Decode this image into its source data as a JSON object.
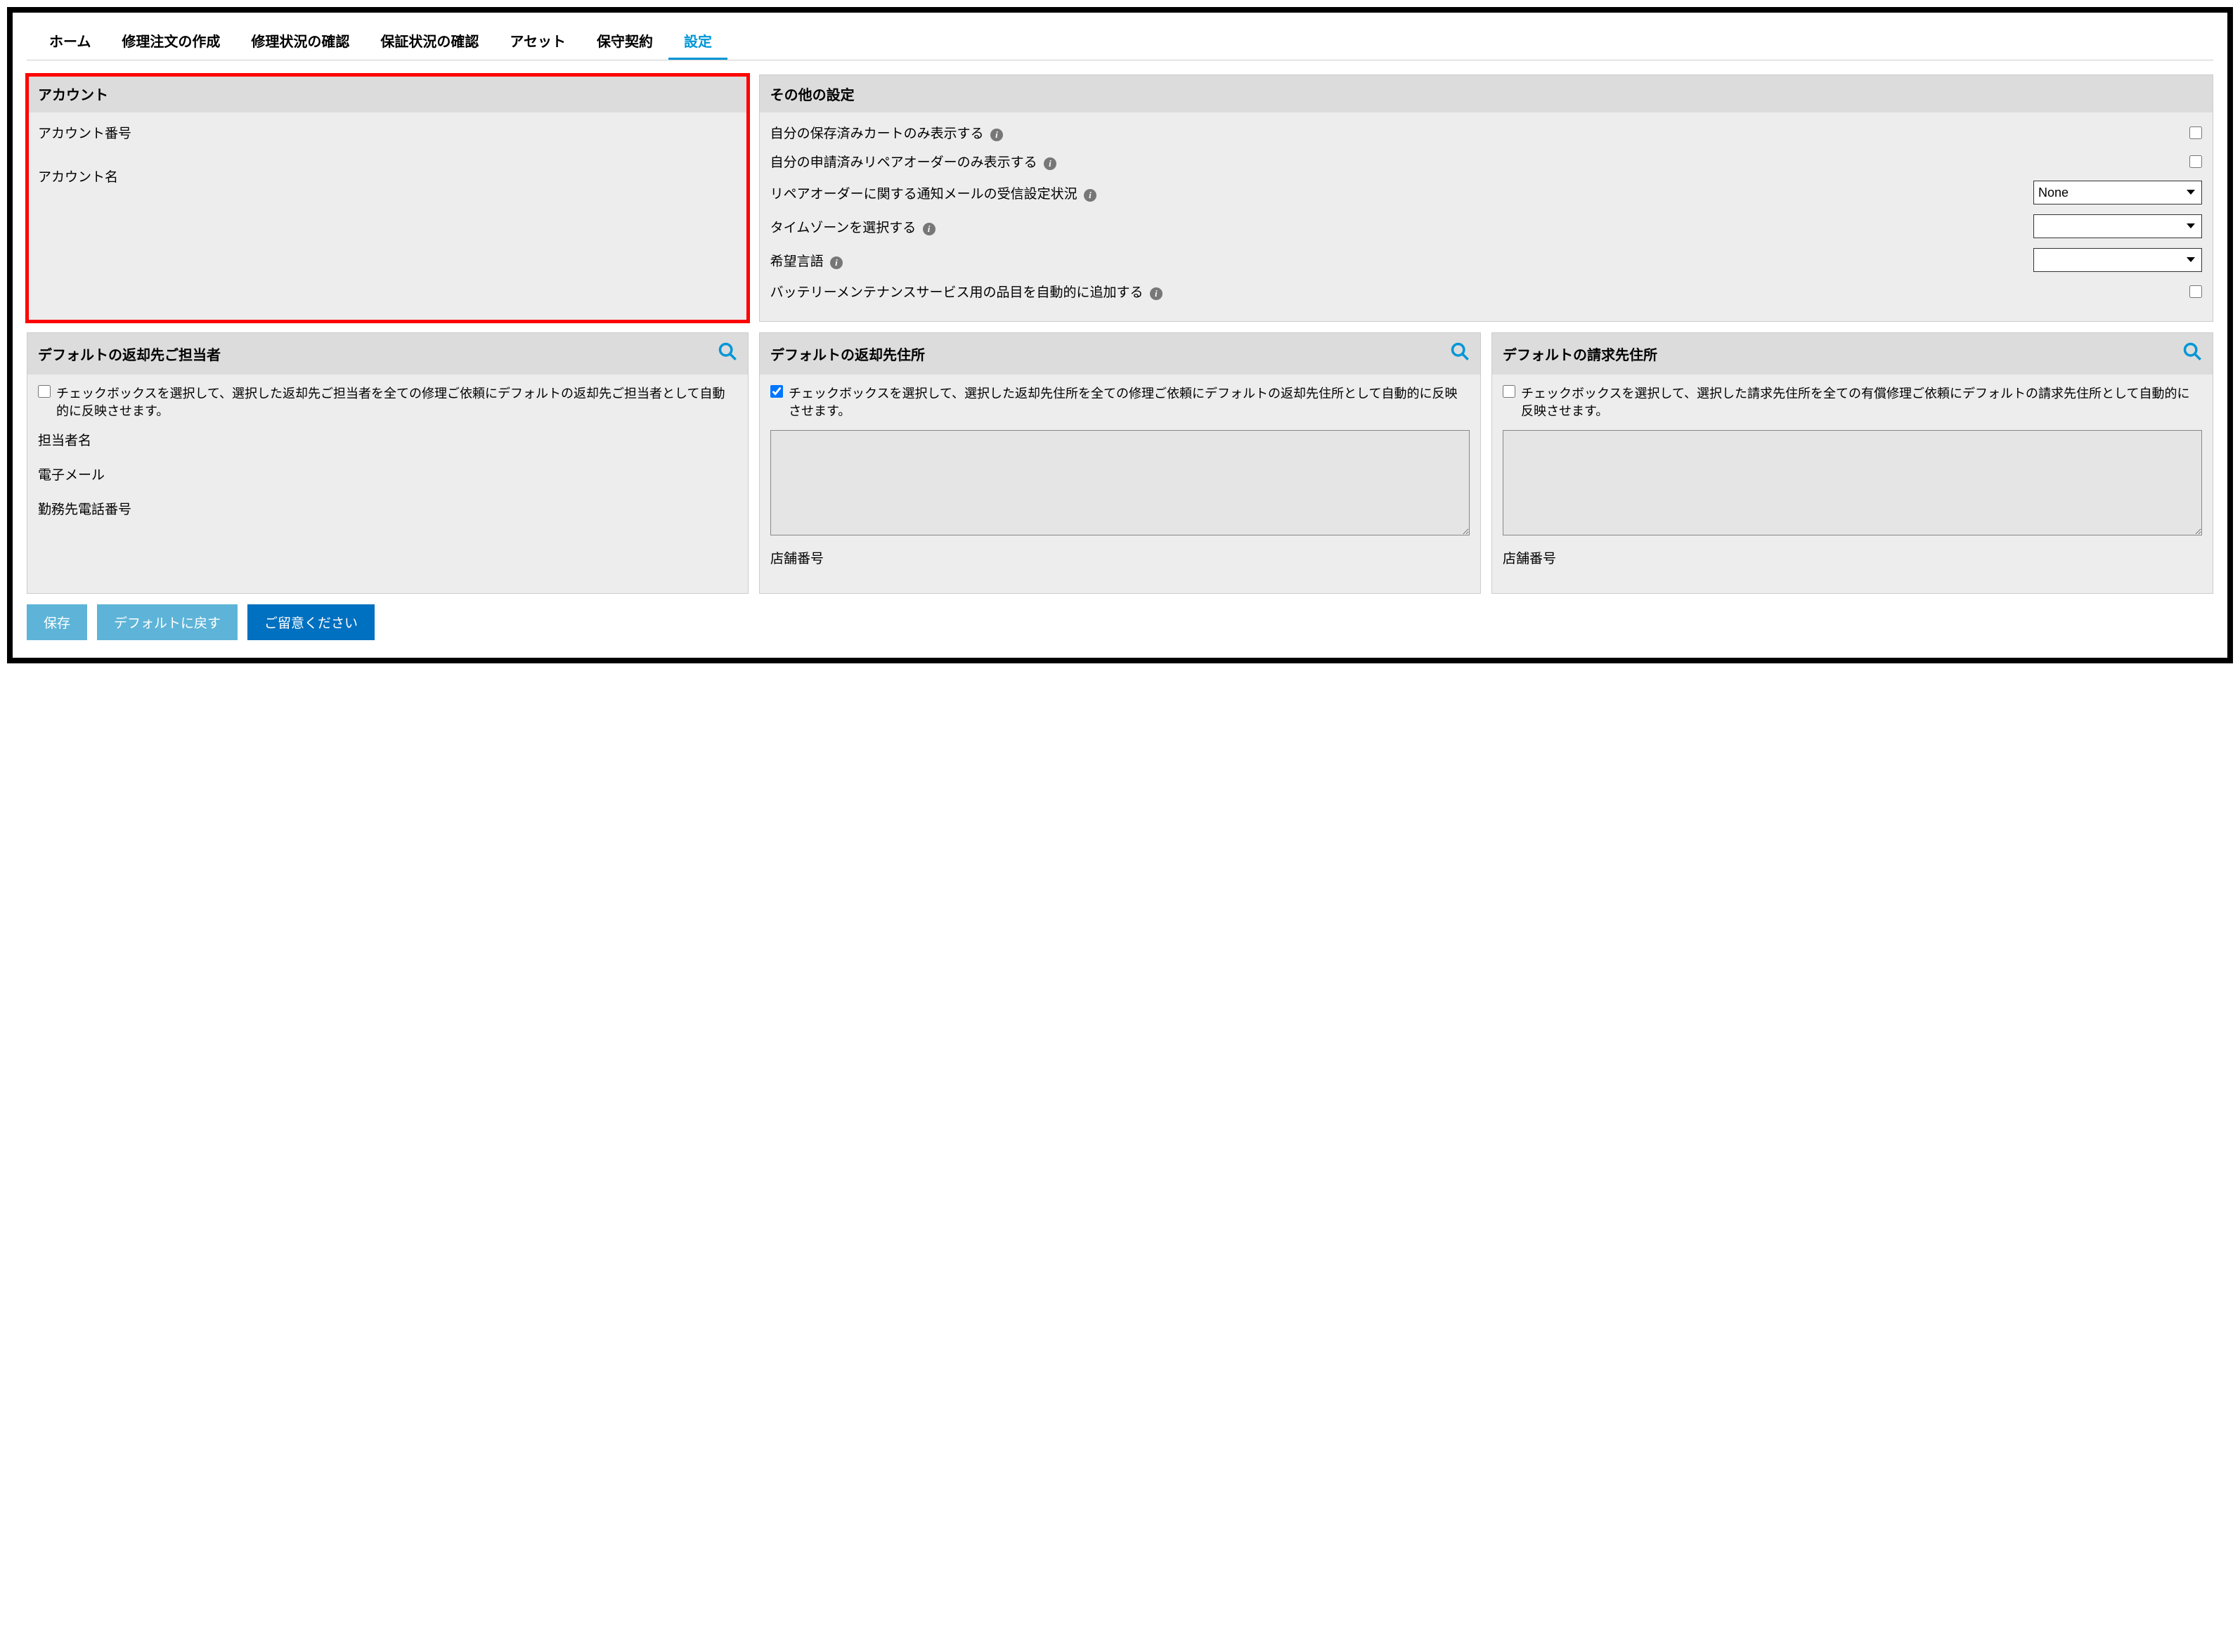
{
  "nav": {
    "tabs": [
      {
        "label": "ホーム"
      },
      {
        "label": "修理注文の作成"
      },
      {
        "label": "修理状況の確認"
      },
      {
        "label": "保証状況の確認"
      },
      {
        "label": "アセット"
      },
      {
        "label": "保守契約"
      },
      {
        "label": "設定"
      }
    ],
    "active_index": 6
  },
  "account": {
    "header": "アカウント",
    "number_label": "アカウント番号",
    "name_label": "アカウント名"
  },
  "other": {
    "header": "その他の設定",
    "show_own_carts_label": "自分の保存済みカートのみ表示する",
    "show_own_repair_orders_label": "自分の申請済みリペアオーダーのみ表示する",
    "repair_order_notify_label": "リペアオーダーに関する通知メールの受信設定状況",
    "repair_order_notify_value": "None",
    "timezone_label": "タイムゾーンを選択する",
    "timezone_value": "",
    "language_label": "希望言語",
    "language_value": "",
    "battery_auto_add_label": "バッテリーメンテナンスサービス用の品目を自動的に追加する"
  },
  "return_contact": {
    "header": "デフォルトの返却先ご担当者",
    "checkbox_text": "チェックボックスを選択して、選択した返却先ご担当者を全ての修理ご依頼にデフォルトの返却先ご担当者として自動的に反映させます。",
    "checked": false,
    "name_label": "担当者名",
    "email_label": "電子メール",
    "phone_label": "勤務先電話番号"
  },
  "return_address": {
    "header": "デフォルトの返却先住所",
    "checkbox_text": "チェックボックスを選択して、選択した返却先住所を全ての修理ご依頼にデフォルトの返却先住所として自動的に反映させます。",
    "checked": true,
    "address_value": "",
    "store_label": "店舗番号"
  },
  "billing_address": {
    "header": "デフォルトの請求先住所",
    "checkbox_text": "チェックボックスを選択して、選択した請求先住所を全ての有償修理ご依頼にデフォルトの請求先住所として自動的に反映させます。",
    "checked": false,
    "address_value": "",
    "store_label": "店舗番号"
  },
  "buttons": {
    "save": "保存",
    "reset": "デフォルトに戻す",
    "note": "ご留意ください"
  }
}
